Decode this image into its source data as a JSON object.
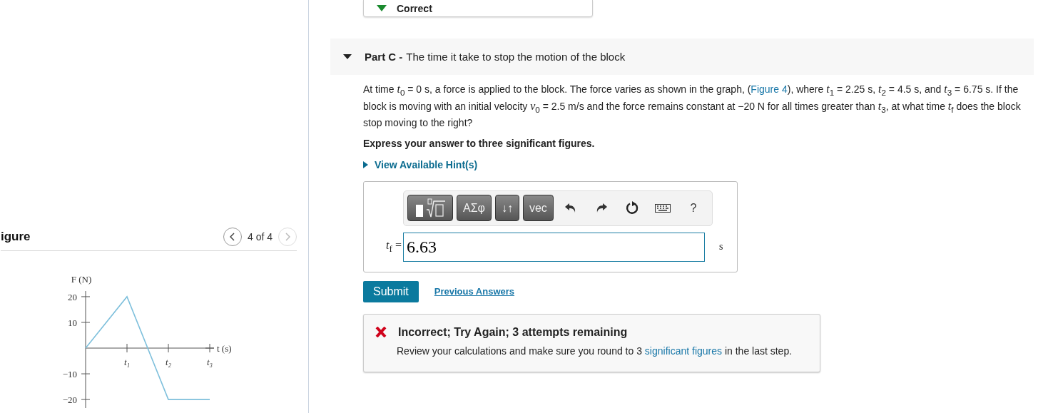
{
  "previous_part": {
    "status": "Correct"
  },
  "figure_panel": {
    "title": "igure",
    "pager": "4 of 4",
    "prev_disabled": false,
    "next_disabled": true,
    "chart_data": {
      "type": "line",
      "xlabel": "t (s)",
      "ylabel": "F (N)",
      "categories": [
        null,
        "t₁",
        "t₂",
        "t₃"
      ],
      "series": [
        {
          "color": "#7fc0dc",
          "values": [
            0,
            20,
            -20,
            -20
          ]
        }
      ],
      "ylim": [
        -23.3,
        22.2
      ],
      "yticks": [
        20,
        10,
        -10,
        -20
      ]
    }
  },
  "part": {
    "expanded": true,
    "label": "Part C -",
    "title": "The time it take to stop the motion of the block",
    "question": [
      {
        "kind": "text",
        "text": "At time *t*$_{0}$ = 0 s, a force is applied to the block. The force varies as shown in the graph, ("
      },
      {
        "kind": "link",
        "text": "Figure 4"
      },
      {
        "kind": "text",
        "text": "), where *t*$_{1}$ = 2.25 s, *t*$_{2}$ = 4.5 s, and *t*$_{3}$ = 6.75 s. If the block is moving with an initial velocity *v*$_{0}$ = 2.5 m/s and the force remains constant at −20 N for all times greater than *t*$_{3}$, at what time *t*$_{f}$ does the block stop moving to the right?"
      }
    ],
    "instruction": "Express your answer to three significant figures.",
    "hint_link": "View Available Hint(s)",
    "toolbar": [
      {
        "kind": "template"
      },
      {
        "kind": "text",
        "text": "ΑΣφ"
      },
      {
        "kind": "text",
        "text": "↓↑"
      },
      {
        "kind": "text",
        "text": "vec"
      },
      {
        "kind": "undo"
      },
      {
        "kind": "redo"
      },
      {
        "kind": "reset"
      },
      {
        "kind": "keyboard"
      },
      {
        "kind": "plain",
        "text": "?"
      }
    ],
    "answer_label": "*t*$_{f}$ =",
    "answer_value": "6.63",
    "unit": "s",
    "submit": "Submit",
    "previous_answers": "Previous Answers",
    "feedback": {
      "correct": false,
      "title": "Incorrect; Try Again; 3 attempts remaining",
      "message": [
        {
          "kind": "text",
          "text": "Review your calculations and make sure you round to 3 "
        },
        {
          "kind": "link",
          "text": "significant figures"
        },
        {
          "kind": "text",
          "text": " in the last step."
        }
      ]
    }
  }
}
